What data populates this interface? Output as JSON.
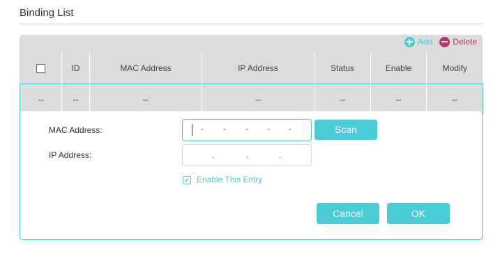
{
  "page": {
    "title": "Binding List"
  },
  "toolbar": {
    "add_label": "Add",
    "delete_label": "Delete"
  },
  "table": {
    "columns": [
      "ID",
      "MAC Address",
      "IP Address",
      "Status",
      "Enable",
      "Modify"
    ],
    "row": [
      "--",
      "--",
      "--",
      "--",
      "--",
      "--",
      "--"
    ]
  },
  "form": {
    "mac_label": "MAC Address:",
    "mac_separator": "-",
    "ip_label": "IP Address:",
    "ip_separator": ".",
    "scan_label": "Scan",
    "enable_label": "Enable This Entry",
    "enable_checked": true,
    "cancel_label": "Cancel",
    "ok_label": "OK"
  },
  "colors": {
    "accent": "#4acbd6",
    "delete": "#b5326b",
    "panel": "#dcdcdc"
  },
  "icons": {
    "add": "plus-circle-icon",
    "delete": "minus-circle-icon"
  }
}
